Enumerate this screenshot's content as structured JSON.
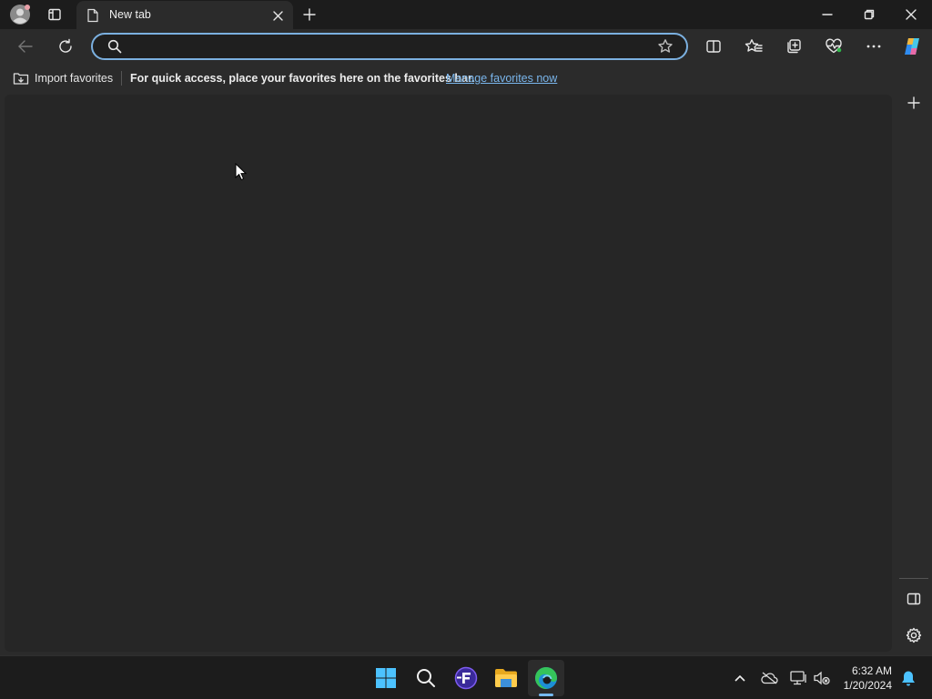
{
  "tab": {
    "title": "New tab"
  },
  "address": {
    "value": "",
    "placeholder": ""
  },
  "favorites_bar": {
    "import_label": "Import favorites",
    "hint": "For quick access, place your favorites here on the favorites bar.",
    "manage_link": "Manage favorites now"
  },
  "taskbar": {
    "time": "6:32 AM",
    "date": "1/20/2024"
  },
  "colors": {
    "accent": "#7bb0e0",
    "link": "#7ab6ec",
    "background": "#262626"
  }
}
